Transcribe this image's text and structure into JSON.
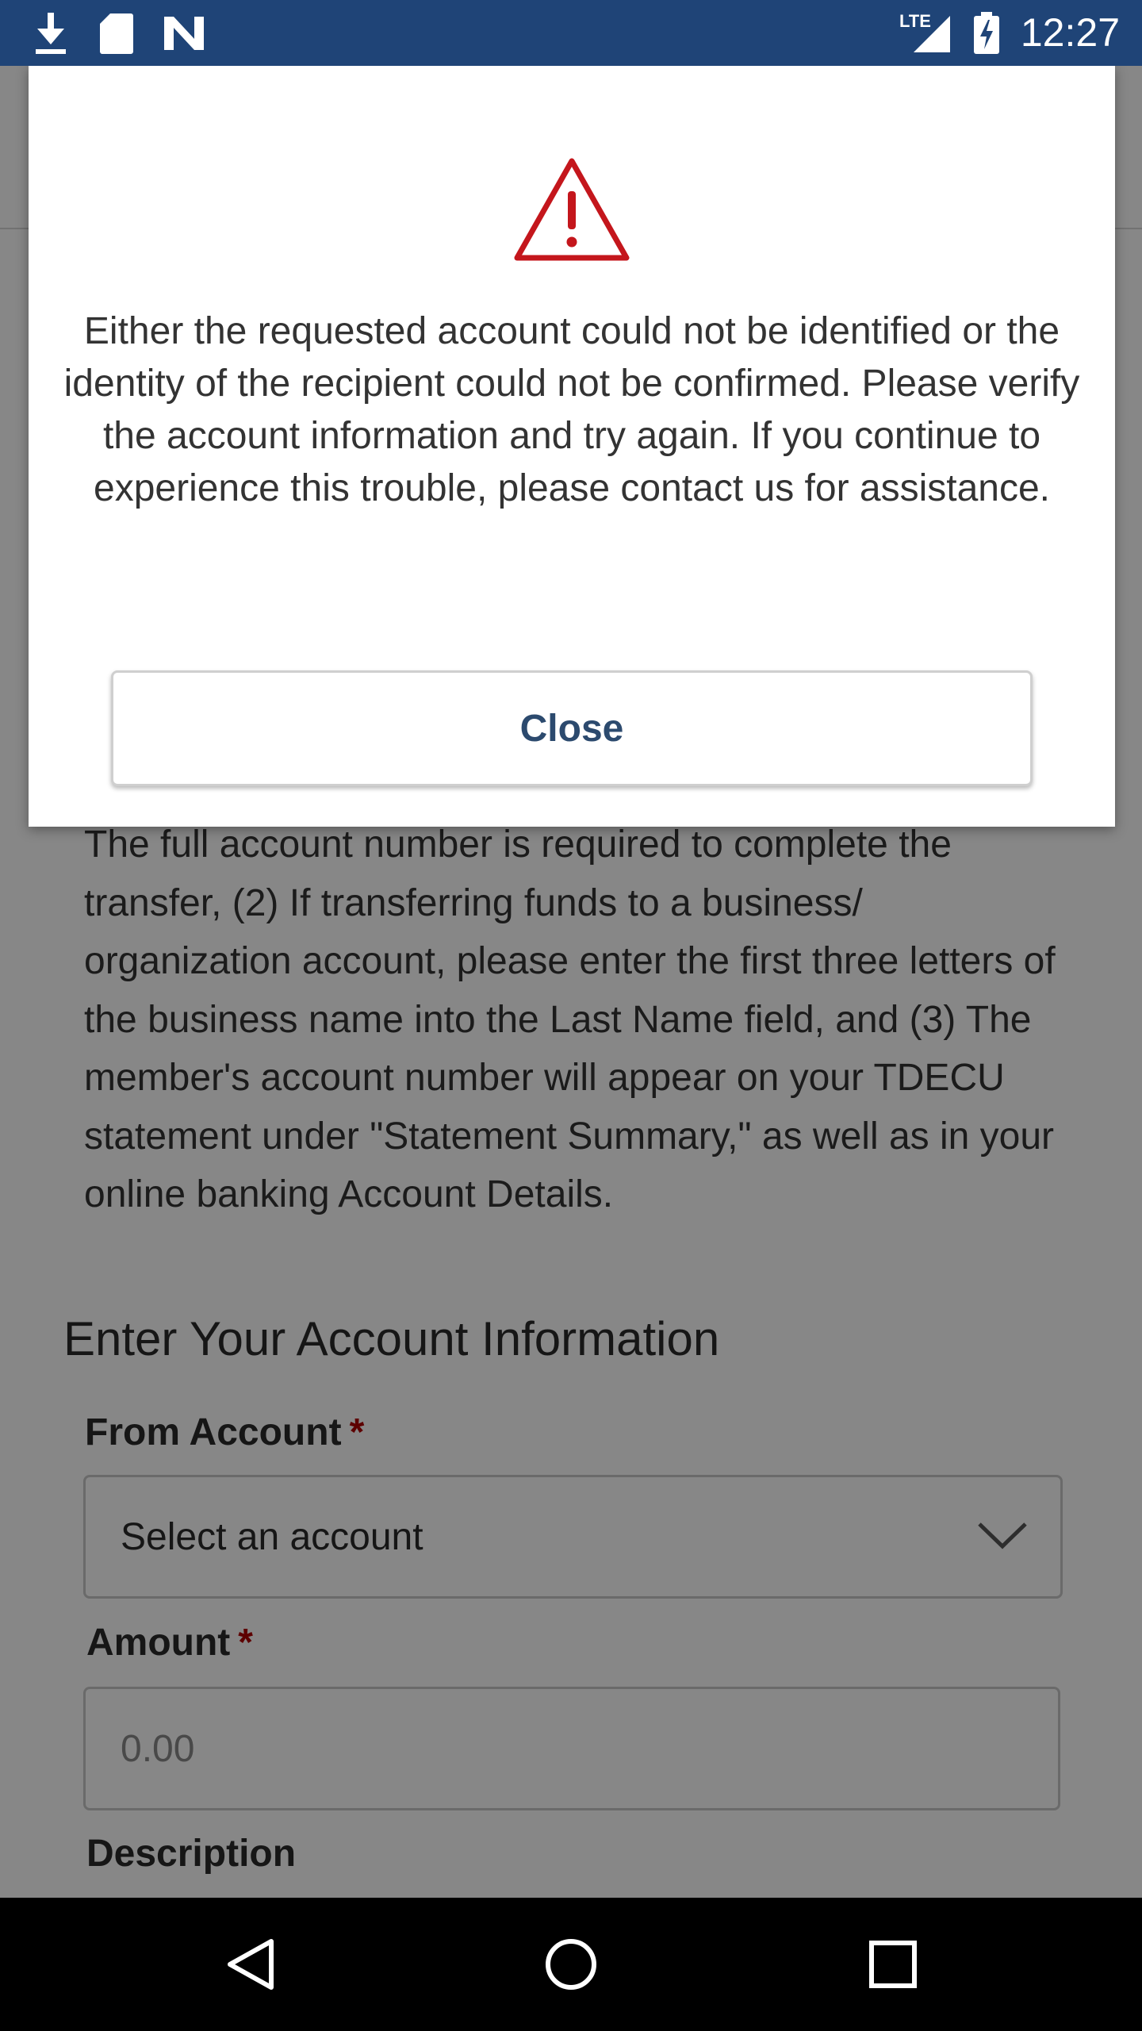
{
  "status_bar": {
    "time": "12:27",
    "network": "LTE",
    "icons": [
      "download-icon",
      "sd-card-icon",
      "n-logo-icon",
      "signal-icon",
      "battery-charging-icon"
    ]
  },
  "page": {
    "intro_text": "The full account number is required to complete the transfer, (2) If transferring funds to a business/ organization account, please enter the first three letters of the business name into the Last Name field, and (3) The member's account number will appear on your TDECU statement under \"Statement Summary,\" as well as in your online banking Account Details.",
    "section_title": "Enter Your Account Information",
    "from_account": {
      "label": "From Account",
      "required_mark": "*",
      "value": "Select an account"
    },
    "amount": {
      "label": "Amount",
      "required_mark": "*",
      "placeholder": "0.00"
    },
    "description": {
      "label": "Description"
    }
  },
  "modal": {
    "icon": "warning-triangle-icon",
    "message": "Either the requested account could not be identified or the identity of the recipient could not be confirmed. Please verify the account information and try again. If you continue to experience this trouble, please contact us for assistance.",
    "close_label": "Close"
  },
  "nav_bar": {
    "buttons": [
      "back-icon",
      "home-icon",
      "recents-icon"
    ]
  },
  "colors": {
    "status_bar": "#1f4477",
    "warning_red": "#c4161c",
    "required_red": "#b00000",
    "button_text": "#2c4a6e"
  }
}
